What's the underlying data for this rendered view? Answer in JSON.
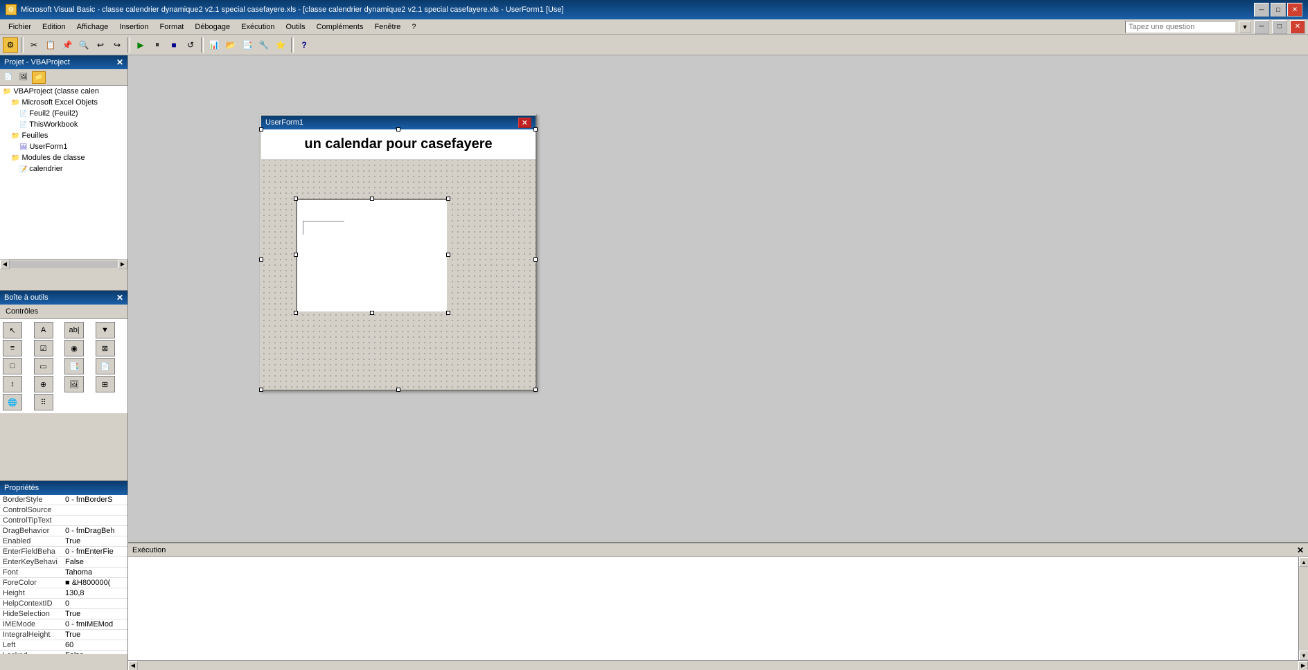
{
  "titleBar": {
    "title": "Microsoft Visual Basic - classe calendrier dynamique2 v2.1 special casefayere.xls - [classe calendrier dynamique2 v2.1 special casefayere.xls - UserForm1 [Use]",
    "controls": {
      "minimize": "─",
      "maximize": "□",
      "close": "✕"
    }
  },
  "menuBar": {
    "items": [
      {
        "label": "Fichier"
      },
      {
        "label": "Edition"
      },
      {
        "label": "Affichage"
      },
      {
        "label": "Insertion"
      },
      {
        "label": "Format"
      },
      {
        "label": "Débogage"
      },
      {
        "label": "Exécution"
      },
      {
        "label": "Outils"
      },
      {
        "label": "Compléments"
      },
      {
        "label": "Fenêtre"
      },
      {
        "label": "?"
      }
    ],
    "search_placeholder": "Tapez une question"
  },
  "projectPanel": {
    "title": "Projet - VBAProject",
    "tree": [
      {
        "label": "VBAProject (classe calen",
        "indent": 0,
        "type": "project"
      },
      {
        "label": "Microsoft Excel Objets",
        "indent": 1,
        "type": "folder"
      },
      {
        "label": "Feuil2 (Feuil2)",
        "indent": 2,
        "type": "file"
      },
      {
        "label": "ThisWorkbook",
        "indent": 2,
        "type": "file"
      },
      {
        "label": "Feuilles",
        "indent": 1,
        "type": "folder"
      },
      {
        "label": "UserForm1",
        "indent": 2,
        "type": "file"
      },
      {
        "label": "Modules de classe",
        "indent": 1,
        "type": "folder"
      },
      {
        "label": "calendrier",
        "indent": 2,
        "type": "vba"
      }
    ]
  },
  "toolboxPanel": {
    "title": "Boîte à outils",
    "tab": "Contrôles",
    "tools": [
      "↖",
      "A",
      "ab|",
      "☑",
      "⊞",
      "☑",
      "◉",
      "⊠",
      "↕",
      "≡",
      "□",
      "◫",
      "⊙",
      "🖼",
      "📷",
      "⚙",
      "🌐",
      "⠿"
    ]
  },
  "propertiesPanel": {
    "title": "Propriétés",
    "properties": [
      {
        "name": "BorderStyle",
        "value": "0 - fmBorderS"
      },
      {
        "name": "ControlSource",
        "value": ""
      },
      {
        "name": "ControlTipText",
        "value": ""
      },
      {
        "name": "DragBehavior",
        "value": "0 - fmDragBeh"
      },
      {
        "name": "Enabled",
        "value": "True"
      },
      {
        "name": "EnterFieldBeha",
        "value": "0 - fmEnterFie"
      },
      {
        "name": "EnterKeyBehavi",
        "value": "False"
      },
      {
        "name": "Font",
        "value": "Tahoma"
      },
      {
        "name": "ForeColor",
        "value": "■ &H800000("
      },
      {
        "name": "Height",
        "value": "130,8"
      },
      {
        "name": "HelpContextID",
        "value": "0"
      },
      {
        "name": "HideSelection",
        "value": "True"
      },
      {
        "name": "IMEMode",
        "value": "0 - fmIMEMod"
      },
      {
        "name": "IntegralHeight",
        "value": "True"
      },
      {
        "name": "Left",
        "value": "60"
      },
      {
        "name": "Locked",
        "value": "False"
      }
    ]
  },
  "userForm": {
    "title": "UserForm1",
    "calendarLabel": "un calendar  pour casefayere"
  },
  "executionPanel": {
    "title": "Exécution"
  }
}
